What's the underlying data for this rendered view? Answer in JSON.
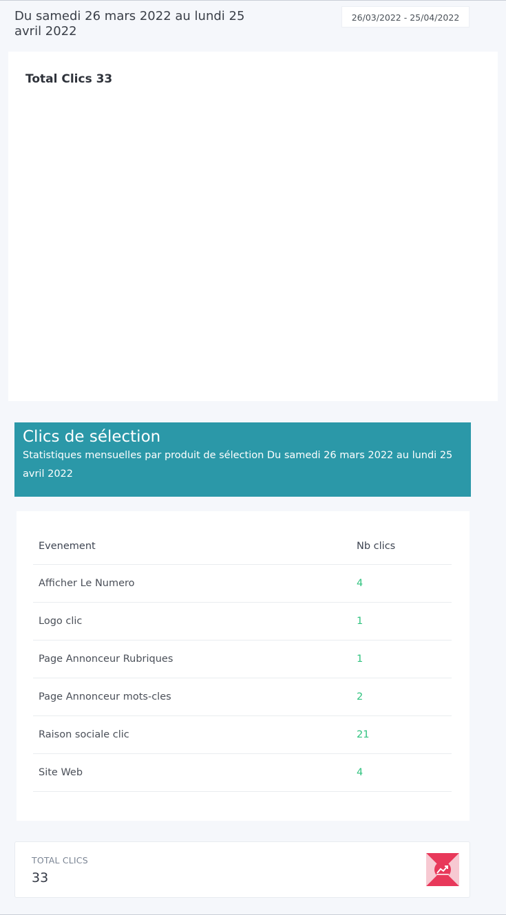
{
  "header": {
    "period_text": "Du samedi 26 mars 2022 au lundi 25 avril 2022",
    "date_range": "26/03/2022 - 25/04/2022"
  },
  "chart_card": {
    "title": "Total Clics 33"
  },
  "selection": {
    "title": "Clics de sélection",
    "subtitle": "Statistiques mensuelles par produit de sélection Du samedi 26 mars 2022 au lundi 25 avril 2022",
    "columns": [
      "Evenement",
      "Nb clics"
    ],
    "rows": [
      {
        "event": "Afficher Le Numero",
        "count": "4"
      },
      {
        "event": "Logo clic",
        "count": "1"
      },
      {
        "event": "Page Annonceur Rubriques",
        "count": "1"
      },
      {
        "event": "Page Annonceur mots-cles",
        "count": "2"
      },
      {
        "event": "Raison sociale clic",
        "count": "21"
      },
      {
        "event": "Site Web",
        "count": "4"
      }
    ]
  },
  "total": {
    "label": "TOTAL CLICS",
    "value": "33",
    "icon": "chart-up-icon"
  },
  "colors": {
    "header_bg": "#2b98a8",
    "count_text": "#2ec27e",
    "icon_accent": "#e8385a"
  }
}
